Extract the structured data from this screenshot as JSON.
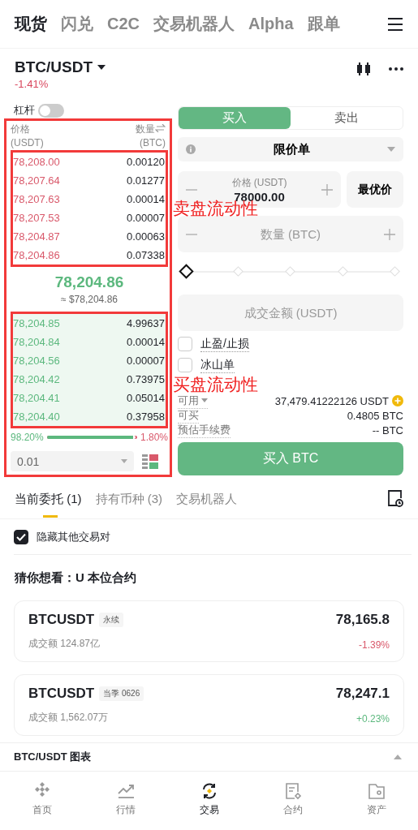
{
  "top_tabs": [
    {
      "label": "现货",
      "selected": true
    },
    {
      "label": "闪兑",
      "selected": false
    },
    {
      "label": "C2C",
      "selected": false
    },
    {
      "label": "交易机器人",
      "selected": false
    },
    {
      "label": "Alpha",
      "selected": false
    },
    {
      "label": "跟单",
      "selected": false
    }
  ],
  "pair": {
    "symbol": "BTC/USDT",
    "change": "-1.41%"
  },
  "leverage": {
    "label": "杠杆",
    "on": false
  },
  "order_book": {
    "highlighted": true,
    "price_header": "价格",
    "price_unit": "(USDT)",
    "qty_header": "数量",
    "qty_unit": "(BTC)",
    "asks": {
      "highlighted": true,
      "annotation": "卖盘流动性",
      "rows": [
        {
          "price": "78,208.00",
          "qty": "0.00120"
        },
        {
          "price": "78,207.64",
          "qty": "0.01277"
        },
        {
          "price": "78,207.63",
          "qty": "0.00014"
        },
        {
          "price": "78,207.53",
          "qty": "0.00007"
        },
        {
          "price": "78,204.87",
          "qty": "0.00063"
        },
        {
          "price": "78,204.86",
          "qty": "0.07338"
        }
      ]
    },
    "mid_price": "78,204.86",
    "mid_fiat": "≈ $78,204.86",
    "bids": {
      "highlighted": true,
      "annotation": "买盘流动性",
      "rows": [
        {
          "price": "78,204.85",
          "qty": "4.99637"
        },
        {
          "price": "78,204.84",
          "qty": "0.00014"
        },
        {
          "price": "78,204.56",
          "qty": "0.00007"
        },
        {
          "price": "78,204.42",
          "qty": "0.73975"
        },
        {
          "price": "78,204.41",
          "qty": "0.05014"
        },
        {
          "price": "78,204.40",
          "qty": "0.37958"
        }
      ]
    },
    "ratio": {
      "buy": "98.20%",
      "sell": "1.80%",
      "level": 0.982
    },
    "precision": "0.01"
  },
  "order_form": {
    "sides": [
      {
        "label": "买入",
        "selected": true
      },
      {
        "label": "卖出",
        "selected": false
      }
    ],
    "order_type": "限价单",
    "price": {
      "label": "价格 (USDT)",
      "value": "78000.00"
    },
    "best_price": "最优价",
    "quantity": {
      "placeholder": "数量 (BTC)"
    },
    "slider": {
      "level": 0
    },
    "total": {
      "placeholder": "成交金额 (USDT)"
    },
    "options": [
      {
        "label": "止盈/止损",
        "checked": false
      },
      {
        "label": "冰山单",
        "checked": false
      }
    ],
    "info": [
      {
        "kind": "available",
        "label": "可用",
        "value": "37,479.41222126 USDT"
      },
      {
        "kind": "plain",
        "label": "可买",
        "value": "0.4805 BTC"
      },
      {
        "kind": "plain",
        "label": "预估手续费",
        "value": "-- BTC"
      }
    ],
    "submit": "买入 BTC"
  },
  "bottom_tabs": [
    {
      "label": "当前委托 (1)",
      "selected": true
    },
    {
      "label": "持有币种 (3)",
      "selected": false
    },
    {
      "label": "交易机器人",
      "selected": false
    }
  ],
  "hide_others": {
    "label": "隐藏其他交易对",
    "checked": true
  },
  "suggest": {
    "title": "猜你想看：U 本位合约",
    "cards": [
      {
        "symbol": "BTCUSDT",
        "tag": "永续",
        "volume": "成交额 124.87亿",
        "price": "78,165.8",
        "change": "-1.39%",
        "color": "#d9596b"
      },
      {
        "symbol": "BTCUSDT",
        "tag": "当季 0626",
        "volume": "成交额 1,562.07万",
        "price": "78,247.1",
        "change": "+0.23%",
        "color": "#5cb87e"
      }
    ]
  },
  "chart_bar": {
    "title": "BTC/USDT 图表"
  },
  "nav": [
    {
      "kind": "home",
      "label": "首页",
      "selected": false
    },
    {
      "kind": "markets",
      "label": "行情",
      "selected": false
    },
    {
      "kind": "trade",
      "label": "交易",
      "selected": true
    },
    {
      "kind": "futures",
      "label": "合约",
      "selected": false
    },
    {
      "kind": "assets",
      "label": "资产",
      "selected": false
    }
  ]
}
